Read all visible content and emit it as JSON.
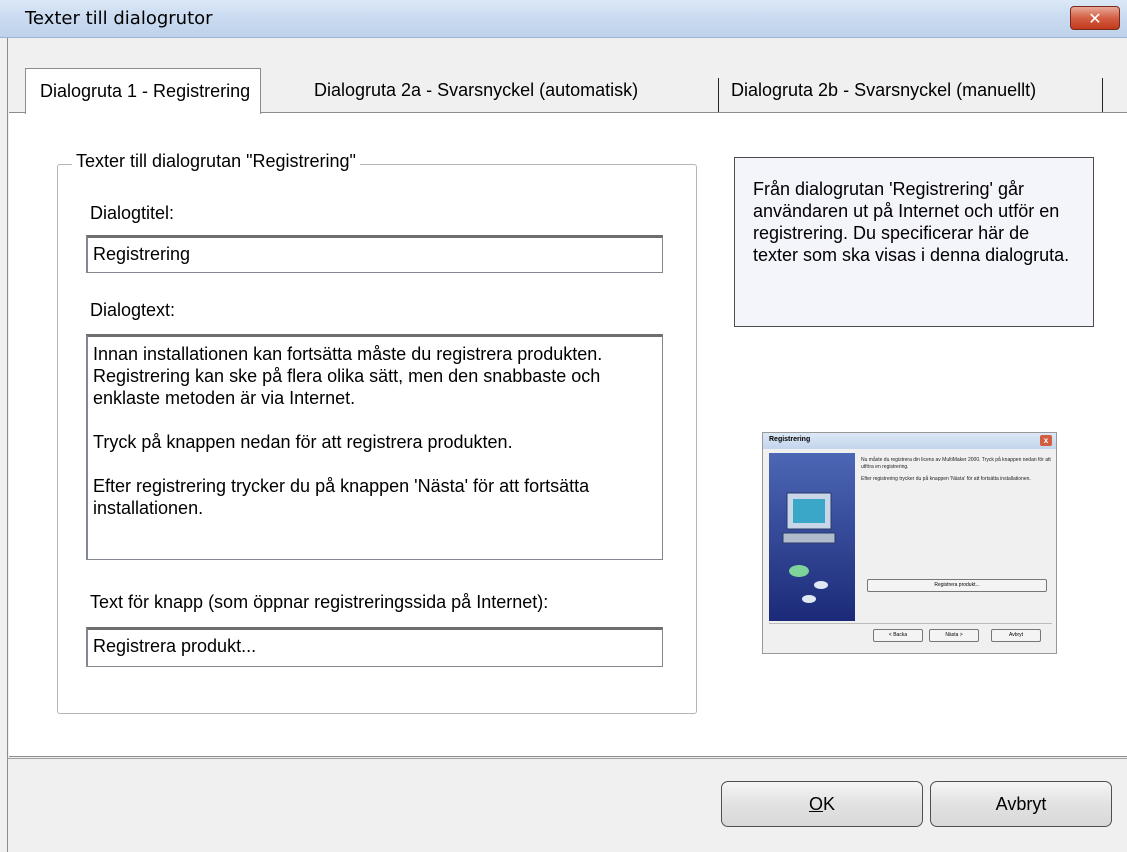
{
  "window": {
    "title": "Texter till dialogrutor",
    "close_glyph": "✕"
  },
  "tabs": [
    {
      "label": "Dialogruta 1 - Registrering"
    },
    {
      "label": "Dialogruta 2a - Svarsnyckel (automatisk)"
    },
    {
      "label": "Dialogruta 2b - Svarsnyckel (manuellt)"
    }
  ],
  "group": {
    "legend": "Texter till dialogrutan \"Registrering\"",
    "dialog_title_label": "Dialogtitel:",
    "dialog_title_value": "Registrering",
    "dialog_text_label": "Dialogtext:",
    "dialog_text_paragraphs": [
      "Innan installationen kan fortsätta måste du registrera produkten. Registrering kan ske på flera olika sätt, men den snabbaste och enklaste metoden är via Internet.",
      "Tryck på knappen nedan för att registrera produkten.",
      "Efter registrering trycker du på knappen 'Nästa' för att fortsätta installationen."
    ],
    "button_text_label": "Text för knapp (som öppnar registreringssida på Internet):",
    "button_text_value": "Registrera produkt..."
  },
  "info": {
    "text": "Från dialogrutan 'Registrering' går användaren ut på Internet och utför en registrering. Du specificerar här de texter som ska visas i denna dialogruta."
  },
  "preview": {
    "title": "Registrering",
    "line1": "Nu måste du registrera din licens av MultiMaker 2000. Tryck på knappen nedan för att utföra en registrering.",
    "line2": "Efter registrering trycker du på knappen 'Nästa' för att fortsätta installationen.",
    "register_button": "Registrera produkt...",
    "back_button": "< Backa",
    "next_button": "Nästa >",
    "cancel_button": "Avbryt"
  },
  "buttons": {
    "ok_accel": "O",
    "ok_rest": "K",
    "cancel": "Avbryt"
  }
}
